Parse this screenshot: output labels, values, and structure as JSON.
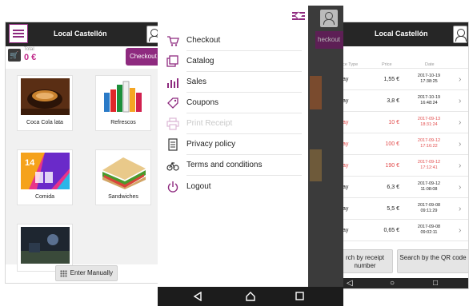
{
  "left_screen": {
    "store_title": "Local Castellón",
    "total_label": "Total",
    "total_value": "0 €",
    "checkout_label": "Checkout",
    "categories": [
      {
        "label": "Coca Cola lata"
      },
      {
        "label": "Refrescos"
      },
      {
        "label": "Comida"
      },
      {
        "label": "Sandwiches"
      },
      {
        "label": ""
      }
    ],
    "comida_badge": "14",
    "enter_manually": "Enter Manually"
  },
  "menu": {
    "items": [
      {
        "label": "Checkout",
        "icon": "cart-icon",
        "enabled": true
      },
      {
        "label": "Catalog",
        "icon": "catalog-icon",
        "enabled": true
      },
      {
        "label": "Sales",
        "icon": "sales-chart-icon",
        "enabled": true
      },
      {
        "label": "Coupons",
        "icon": "tag-icon",
        "enabled": true
      },
      {
        "label": "Print Receipt",
        "icon": "printer-icon",
        "enabled": false
      },
      {
        "label": "Privacy policy",
        "icon": "document-icon",
        "enabled": true
      },
      {
        "label": "Terms and conditions",
        "icon": "bicycle-icon",
        "enabled": true
      },
      {
        "label": "Logout",
        "icon": "power-icon",
        "enabled": true
      }
    ],
    "background_checkout": "heckout"
  },
  "right_screen": {
    "store_title": "Local Castellón",
    "columns": {
      "type": "nce Type",
      "price": "Price",
      "date": "Date"
    },
    "rows": [
      {
        "type": "ay",
        "price": "1,55 €",
        "date": "2017-10-19",
        "time": "17:38:25",
        "refund": false
      },
      {
        "type": "ay",
        "price": "3,8 €",
        "date": "2017-10-19",
        "time": "16:48:24",
        "refund": false
      },
      {
        "type": "ay",
        "price": "10 €",
        "date": "2017-09-13",
        "time": "18:31:24",
        "refund": true
      },
      {
        "type": "ay",
        "price": "100 €",
        "date": "2017-09-12",
        "time": "17:16:22",
        "refund": true
      },
      {
        "type": "ay",
        "price": "190 €",
        "date": "2017-09-12",
        "time": "17:12:41",
        "refund": true
      },
      {
        "type": "ay",
        "price": "6,3 €",
        "date": "2017-09-12",
        "time": "11:08:08",
        "refund": false
      },
      {
        "type": "ay",
        "price": "5,5 €",
        "date": "2017-09-08",
        "time": "09:11:29",
        "refund": false
      },
      {
        "type": "ay",
        "price": "0,65 €",
        "date": "2017-09-08",
        "time": "09:02:11",
        "refund": false
      }
    ],
    "search_receipt": "rch by receipt number",
    "search_qr": "Search by the QR code"
  },
  "colors": {
    "brand_purple": "#8e2a7f",
    "total_pink": "#c22d8c",
    "refund_red": "#e24b4b",
    "topbar_dark": "#262626"
  }
}
